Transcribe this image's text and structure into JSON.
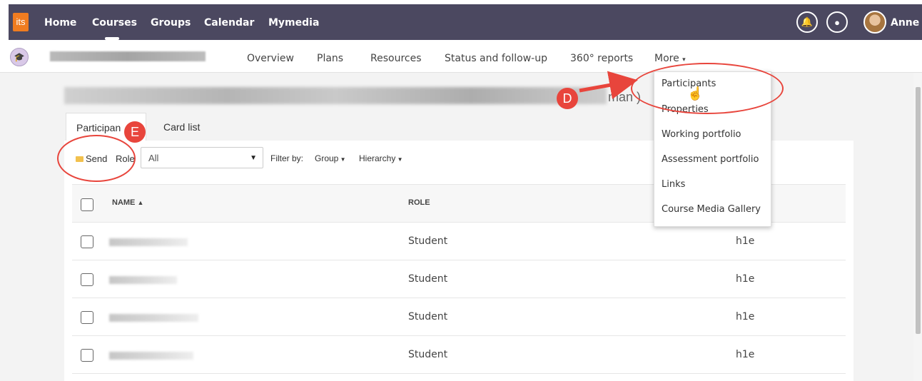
{
  "topnav": {
    "logo": "its",
    "items": [
      "Home",
      "Courses",
      "Groups",
      "Calendar",
      "Mymedia"
    ],
    "user": "Anne"
  },
  "subnav": {
    "items": [
      "Overview",
      "Plans",
      "Resources",
      "Status and follow-up",
      "360° reports",
      "More"
    ]
  },
  "page": {
    "heading_end": "man )",
    "tabs": [
      "Participants",
      "Card list"
    ],
    "tab_visible_text": "Participan"
  },
  "toolbar": {
    "send": "Send",
    "role_label": "Role",
    "role_select": "All",
    "filter_label": "Filter by:",
    "group": "Group",
    "hierarchy": "Hierarchy"
  },
  "table": {
    "headers": [
      "NAME",
      "ROLE"
    ],
    "rows": [
      {
        "role": "Student",
        "group": "h1e"
      },
      {
        "role": "Student",
        "group": "h1e"
      },
      {
        "role": "Student",
        "group": "h1e"
      },
      {
        "role": "Student",
        "group": "h1e"
      }
    ]
  },
  "menu": {
    "items": [
      "Participants",
      "Properties",
      "Working portfolio",
      "Assessment portfolio",
      "Links",
      "Course Media Gallery"
    ]
  },
  "annotations": {
    "d": "D",
    "e": "E"
  },
  "colors": {
    "topbar": "#4b4860",
    "accent": "#f07c20",
    "annotation": "#e8453c"
  }
}
